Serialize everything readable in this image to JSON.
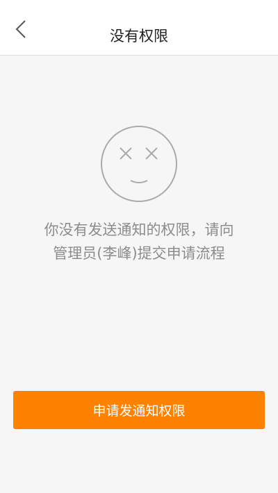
{
  "header": {
    "title": "没有权限",
    "back_icon": "chevron-left-icon"
  },
  "empty_state": {
    "icon": "sad-face-icon",
    "message_line1": "你没有发送通知的权限，请向",
    "message_line2": "管理员(李峰)提交申请流程"
  },
  "actions": {
    "apply_label": "申请发通知权限"
  },
  "colors": {
    "accent": "#ff8100",
    "background": "#f6f6f6",
    "text_secondary": "#8c8c8c"
  }
}
